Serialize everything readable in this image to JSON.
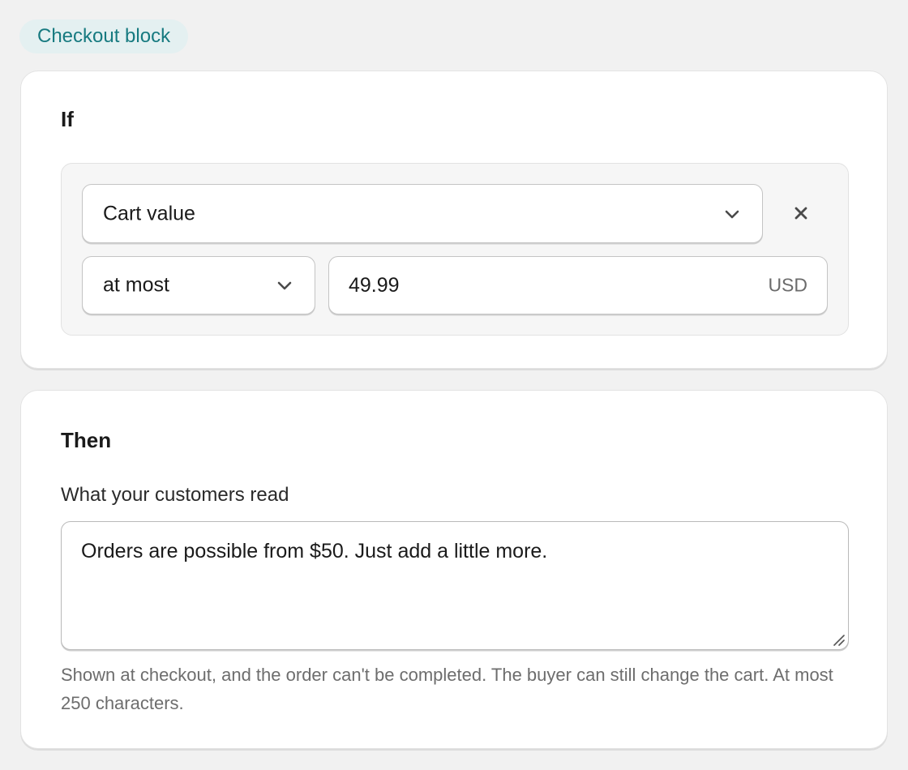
{
  "badge": {
    "label": "Checkout block"
  },
  "if_section": {
    "heading": "If",
    "condition": {
      "field": "Cart value",
      "operator": "at most",
      "amount": "49.99",
      "currency": "USD"
    }
  },
  "then_section": {
    "heading": "Then",
    "message_label": "What your customers read",
    "message_value": "Orders are possible from $50. Just add a little more.",
    "help_text": "Shown at checkout, and the order can't be completed. The buyer can still change the cart. At most 250 characters."
  },
  "icons": {
    "dropdown": "chevron-down-icon",
    "remove": "close-icon",
    "resize": "resize-handle-icon"
  },
  "colors": {
    "badge_bg": "#e4f0f1",
    "badge_text": "#177a80",
    "page_bg": "#f1f1f1"
  }
}
